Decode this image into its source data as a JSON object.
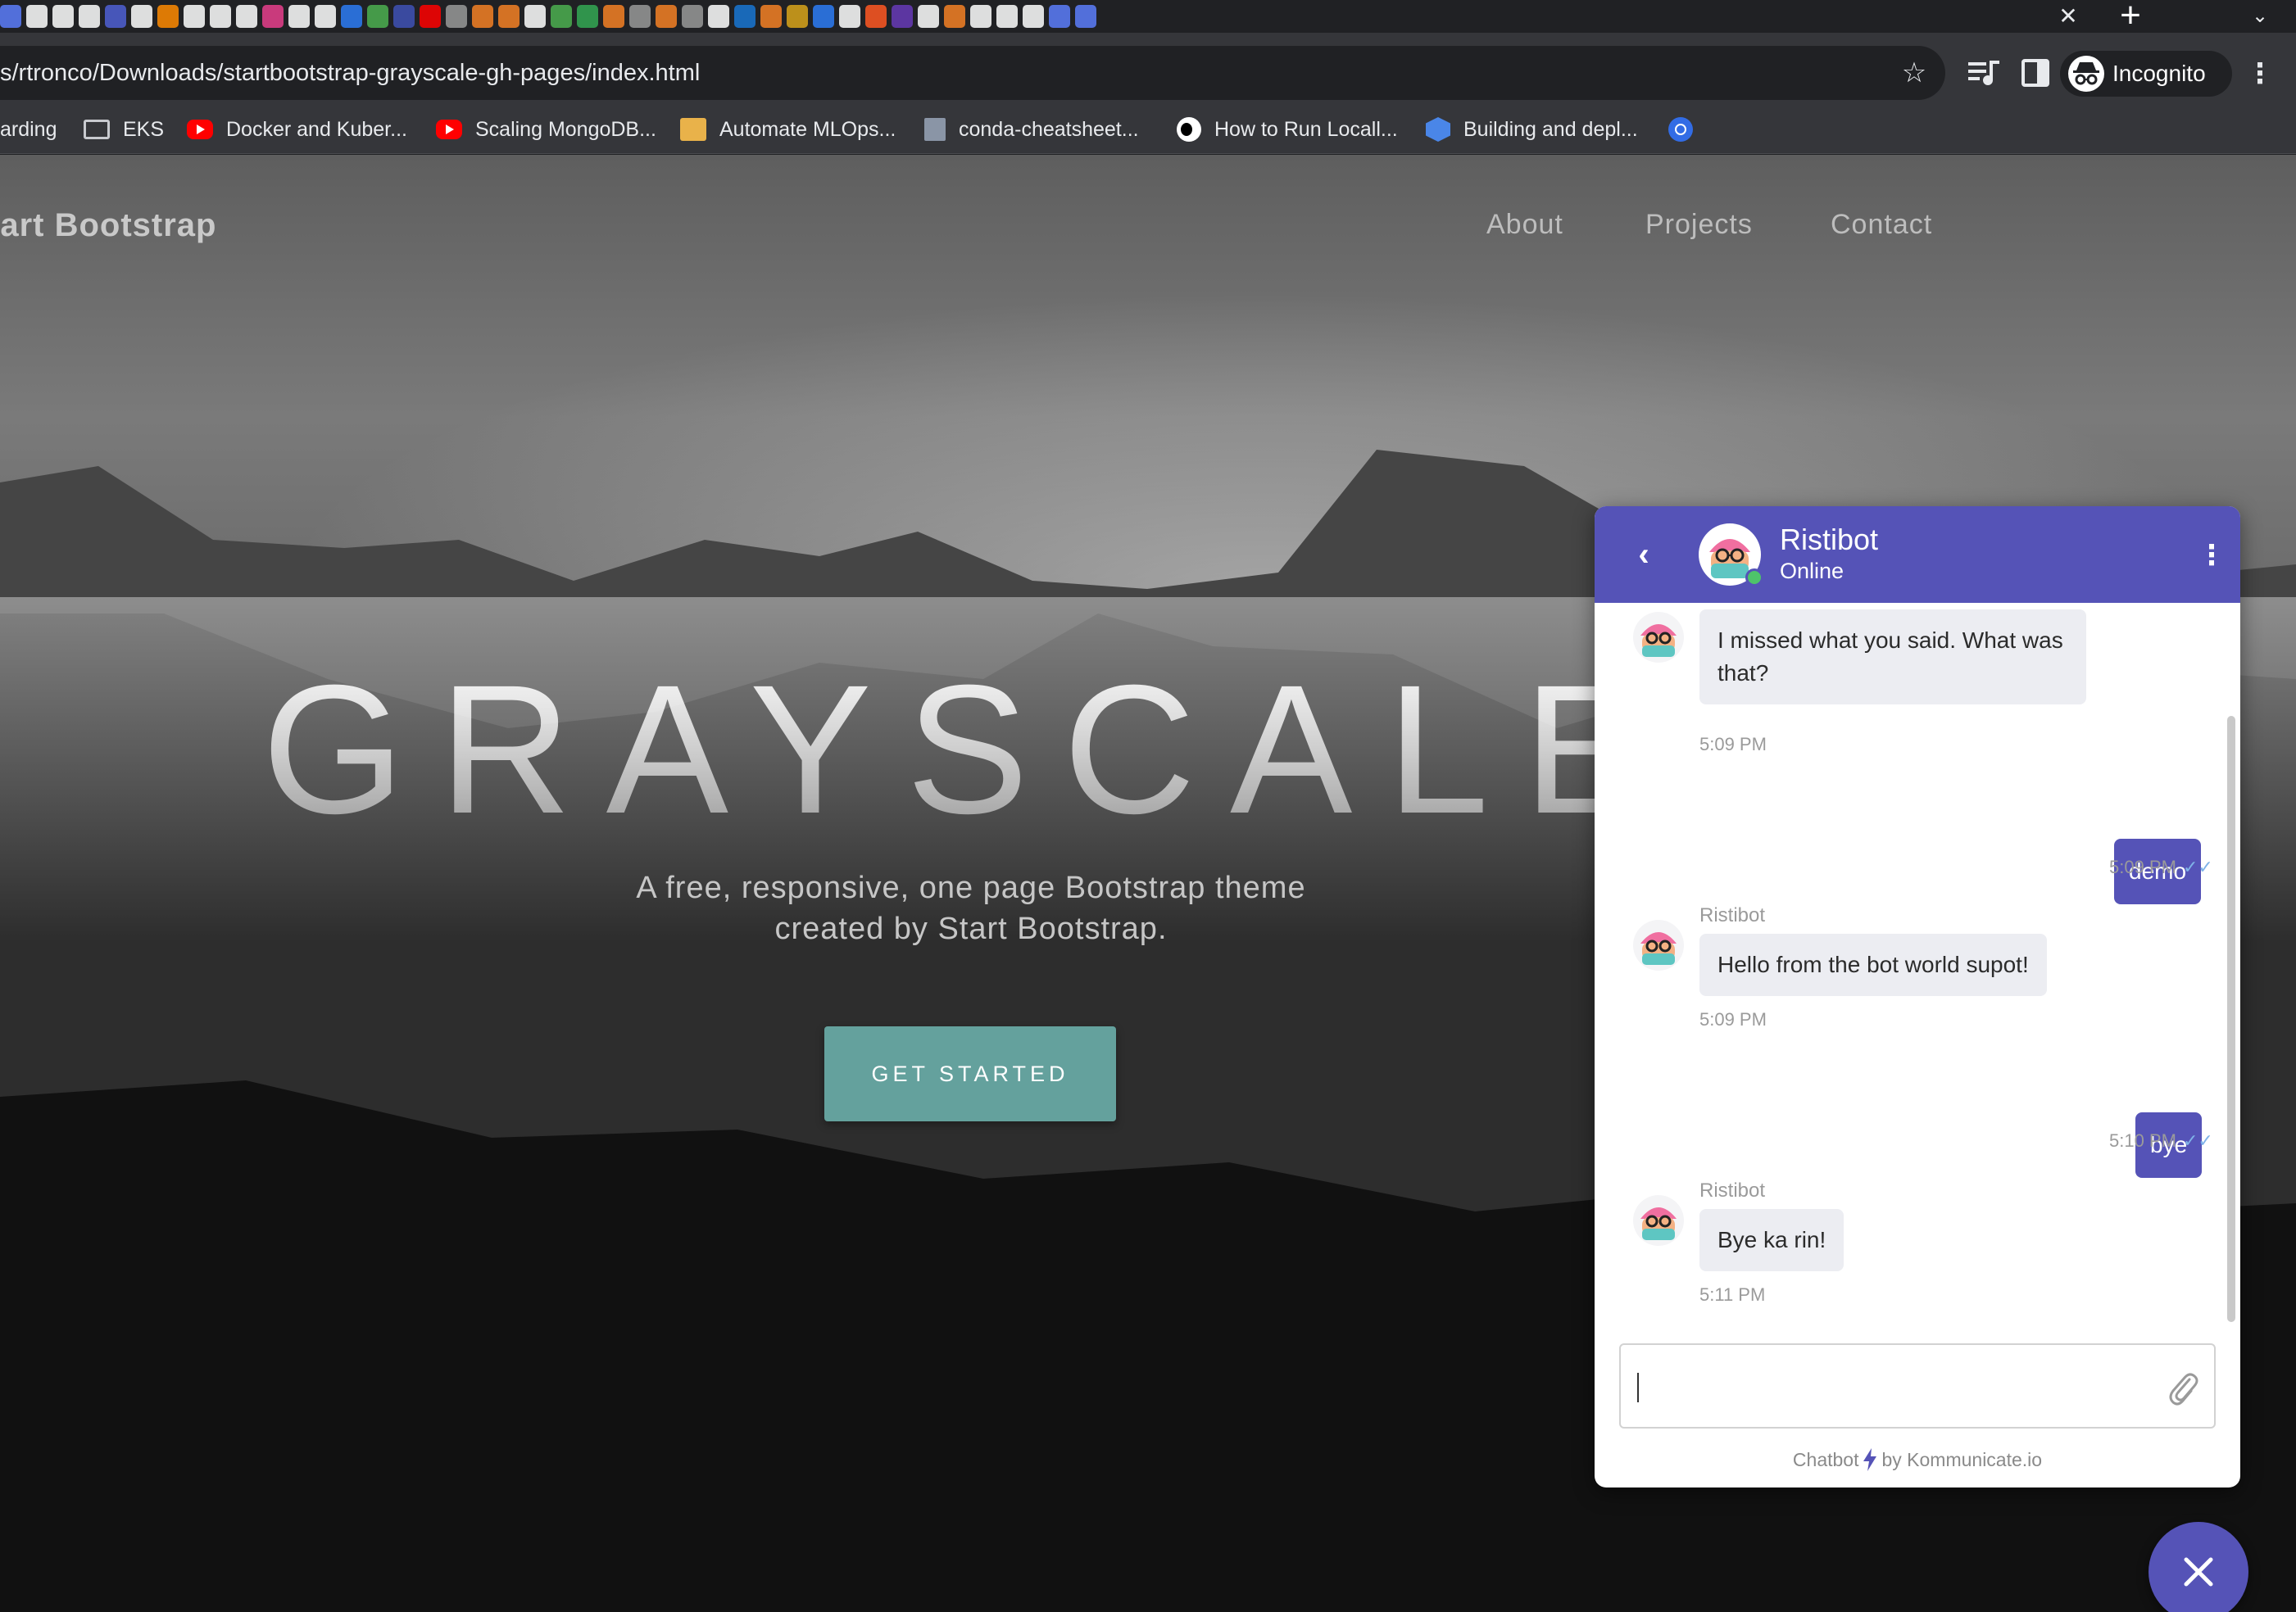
{
  "browser": {
    "url": "s/rtronco/Downloads/startbootstrap-grayscale-gh-pages/index.html",
    "profile_label": "Incognito",
    "tab_favicon_colors": [
      "#5c7cfa",
      "#ffffff",
      "#ffffff",
      "#ffffff",
      "#4f5fd3",
      "#ffffff",
      "#ff8a00",
      "#ffffff",
      "#ffffff",
      "#ffffff",
      "#e83e8c",
      "#ffffff",
      "#ffffff",
      "#2d7bf4",
      "#4caf50",
      "#3f51b5",
      "#ff0000",
      "#999999",
      "#f48024",
      "#f48024",
      "#ffffff",
      "#4caf50",
      "#34a853",
      "#f48024",
      "#999999",
      "#f48024",
      "#999999",
      "#ffffff",
      "#1976d2",
      "#f48024",
      "#d8a31a",
      "#2d7bf4",
      "#ffffff",
      "#ff5722",
      "#673ab7",
      "#ffffff",
      "#f48024",
      "#ffffff",
      "#ffffff",
      "#ffffff",
      "#5c7cfa",
      "#5c7cfa"
    ],
    "icons": {
      "tab_close": "close-icon",
      "new_tab": "plus-icon",
      "tab_search": "chevron-down-icon",
      "bookmark_star": "star-icon",
      "media": "media-control-icon",
      "side_panel": "side-panel-icon",
      "incognito": "incognito-icon",
      "menu": "vertical-ellipsis-icon"
    },
    "bookmarks": [
      {
        "label": "arding",
        "icon": "none"
      },
      {
        "label": "EKS",
        "icon": "folder-icon"
      },
      {
        "label": "Docker and Kuber...",
        "icon": "youtube-icon"
      },
      {
        "label": "Scaling MongoDB...",
        "icon": "youtube-icon"
      },
      {
        "label": "Automate MLOps...",
        "icon": "box-icon"
      },
      {
        "label": "conda-cheatsheet...",
        "icon": "document-icon"
      },
      {
        "label": "How to Run Locall...",
        "icon": "medium-icon"
      },
      {
        "label": "Building and depl...",
        "icon": "aws-icon"
      },
      {
        "label": "",
        "icon": "kubernetes-icon"
      }
    ]
  },
  "site": {
    "brand": "tart Bootstrap",
    "nav": [
      "About",
      "Projects",
      "Contact"
    ],
    "hero_title": "GRAYSCALE",
    "hero_subtitle_line1": "A free, responsive, one page Bootstrap theme",
    "hero_subtitle_line2": "created by Start Bootstrap.",
    "cta_label": "GET STARTED",
    "cta_color": "#64a19d"
  },
  "chat": {
    "accent_color": "#5553b7",
    "bot_name": "Ristibot",
    "status": "Online",
    "messages": [
      {
        "from": "bot",
        "sender": "",
        "text": "I missed what you said. What was that?",
        "time": "5:09 PM"
      },
      {
        "from": "user",
        "text": "demo",
        "time": "5:09 PM",
        "read": true
      },
      {
        "from": "bot",
        "sender": "Ristibot",
        "text": "Hello from the bot world supot!",
        "time": "5:09 PM"
      },
      {
        "from": "user",
        "text": "bye",
        "time": "5:10 PM",
        "read": true
      },
      {
        "from": "bot",
        "sender": "Ristibot",
        "text": "Bye ka rin!",
        "time": "5:11 PM"
      }
    ],
    "input_placeholder": "",
    "powered_by_prefix": "Chatbot",
    "powered_by_suffix": "by Kommunicate.io",
    "icons": {
      "back": "back-arrow-icon",
      "menu": "vertical-ellipsis-icon",
      "attach": "paperclip-icon",
      "close_launcher": "close-icon"
    }
  }
}
